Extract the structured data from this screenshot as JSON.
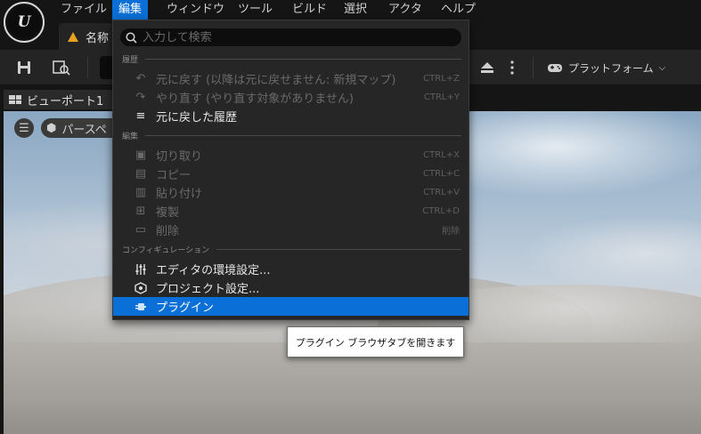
{
  "menubar": {
    "items": [
      {
        "label": "ファイル"
      },
      {
        "label": "編集"
      },
      {
        "label": "ウィンドウ"
      },
      {
        "label": "ツール"
      },
      {
        "label": "ビルド"
      },
      {
        "label": "選択"
      },
      {
        "label": "アクタ"
      },
      {
        "label": "ヘルプ"
      }
    ],
    "active_index": 1
  },
  "level_tab": {
    "label": "名称"
  },
  "toolbar": {
    "platform_label": "プラットフォーム"
  },
  "viewport": {
    "tab_label": "ビューポート1",
    "perspective_label": "パースペ"
  },
  "edit_menu": {
    "search_placeholder": "入力して検索",
    "sections": [
      {
        "label": "履歴",
        "items": [
          {
            "label": "元に戻す (以降は元に戻せません: 新規マップ)",
            "shortcut": "CTRL+Z",
            "icon": "undo-icon",
            "enabled": false
          },
          {
            "label": "やり直す (やり直す対象がありません)",
            "shortcut": "CTRL+Y",
            "icon": "redo-icon",
            "enabled": false
          },
          {
            "label": "元に戻した履歴",
            "shortcut": "",
            "icon": "history-icon",
            "enabled": true
          }
        ]
      },
      {
        "label": "編集",
        "items": [
          {
            "label": "切り取り",
            "shortcut": "CTRL+X",
            "icon": "cut-icon",
            "enabled": false
          },
          {
            "label": "コピー",
            "shortcut": "CTRL+C",
            "icon": "copy-icon",
            "enabled": false
          },
          {
            "label": "貼り付け",
            "shortcut": "CTRL+V",
            "icon": "paste-icon",
            "enabled": false
          },
          {
            "label": "複製",
            "shortcut": "CTRL+D",
            "icon": "duplicate-icon",
            "enabled": false
          },
          {
            "label": "削除",
            "shortcut": "削除",
            "icon": "trash-icon",
            "enabled": false
          }
        ]
      },
      {
        "label": "コンフィギュレーション",
        "items": [
          {
            "label": "エディタの環境設定...",
            "shortcut": "",
            "icon": "sliders-icon",
            "enabled": true
          },
          {
            "label": "プロジェクト設定...",
            "shortcut": "",
            "icon": "project-settings-icon",
            "enabled": true
          },
          {
            "label": "プラグイン",
            "shortcut": "",
            "icon": "plugin-icon",
            "enabled": true,
            "highlighted": true
          }
        ]
      }
    ]
  },
  "tooltip": {
    "text": "プラグイン ブラウザタブを開きます"
  },
  "colors": {
    "accent": "#0a6fd6",
    "menu_bg": "#262626",
    "warning": "#e8a020"
  }
}
